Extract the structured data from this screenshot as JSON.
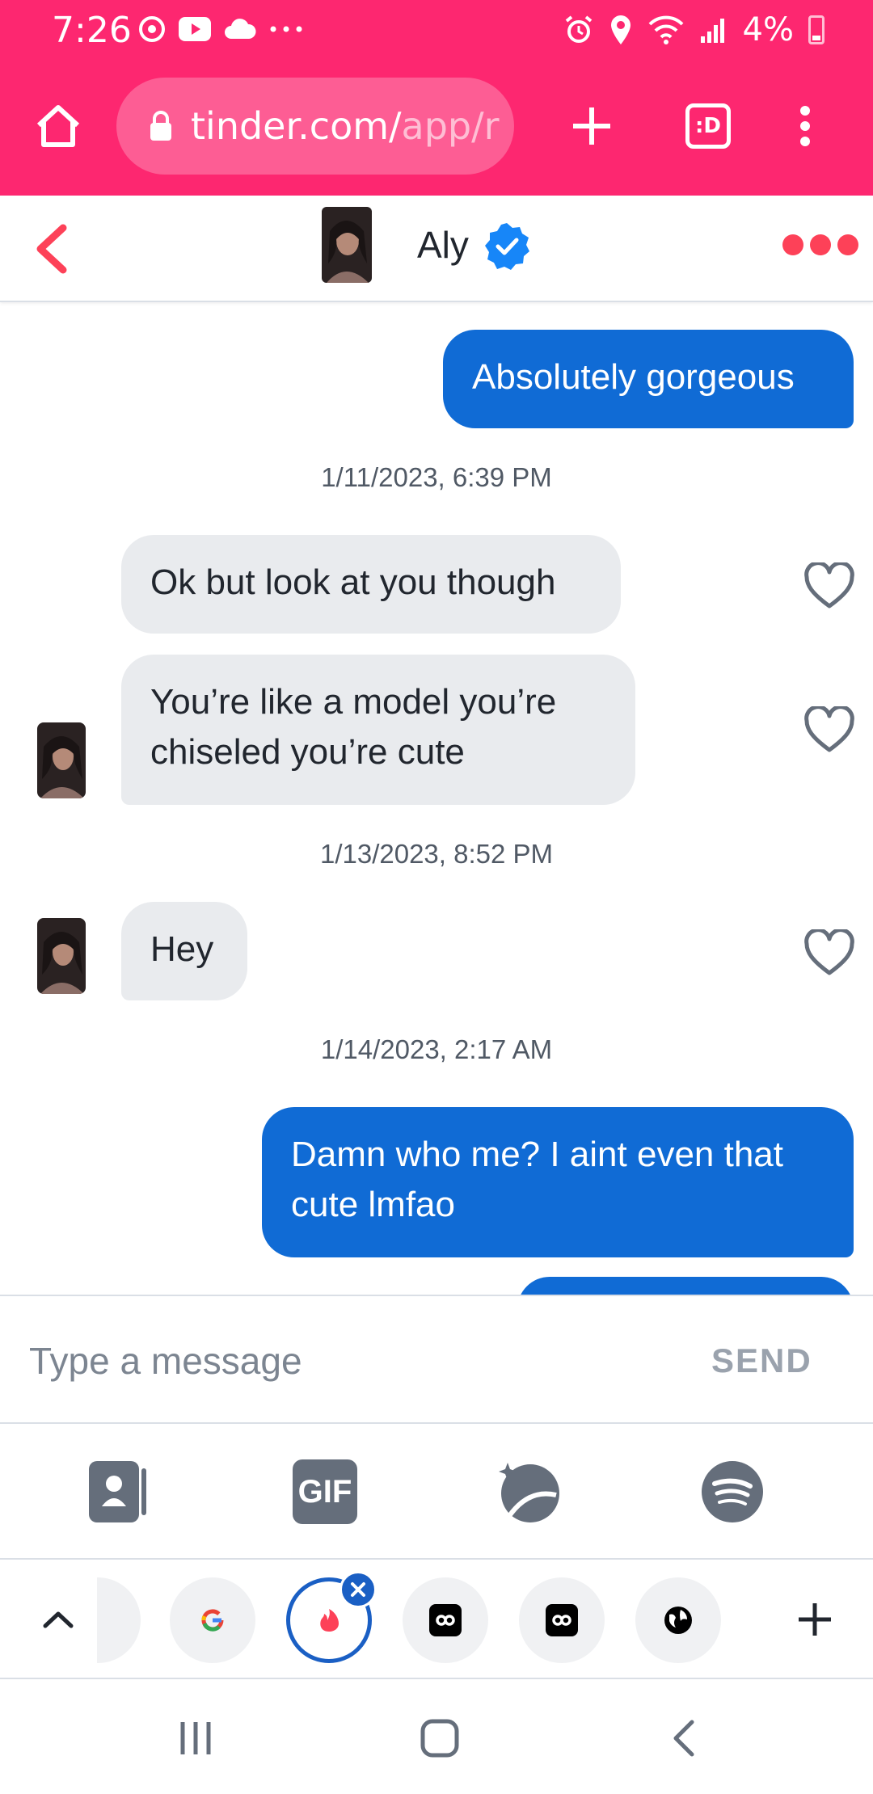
{
  "status_bar": {
    "time": "7:26",
    "battery": "4%"
  },
  "browser": {
    "url_main": "tinder.com/",
    "url_faded": "app/r",
    "tab_switcher_label": ":D"
  },
  "chat": {
    "contact_name": "Aly",
    "messages": [
      {
        "type": "sent",
        "text": "Absolutely gorgeous"
      },
      {
        "type": "timestamp",
        "text": "1/11/2023, 6:39 PM"
      },
      {
        "type": "received",
        "text": "Ok but look at you though"
      },
      {
        "type": "received",
        "text": "You’re like a model you’re chiseled you’re cute"
      },
      {
        "type": "timestamp",
        "text": "1/13/2023, 8:52 PM"
      },
      {
        "type": "received",
        "text": "Hey"
      },
      {
        "type": "timestamp",
        "text": "1/14/2023, 2:17 AM"
      },
      {
        "type": "sent",
        "text": "Damn who me? I aint even that cute lmfao"
      }
    ]
  },
  "composer": {
    "placeholder": "Type a message",
    "send_label": "SEND",
    "gif_label": "GIF"
  },
  "colors": {
    "brand_pink": "#fd2770",
    "sent_bubble": "#106bd5",
    "received_bubble": "#e9ebee",
    "verified_blue": "#1786f8"
  }
}
